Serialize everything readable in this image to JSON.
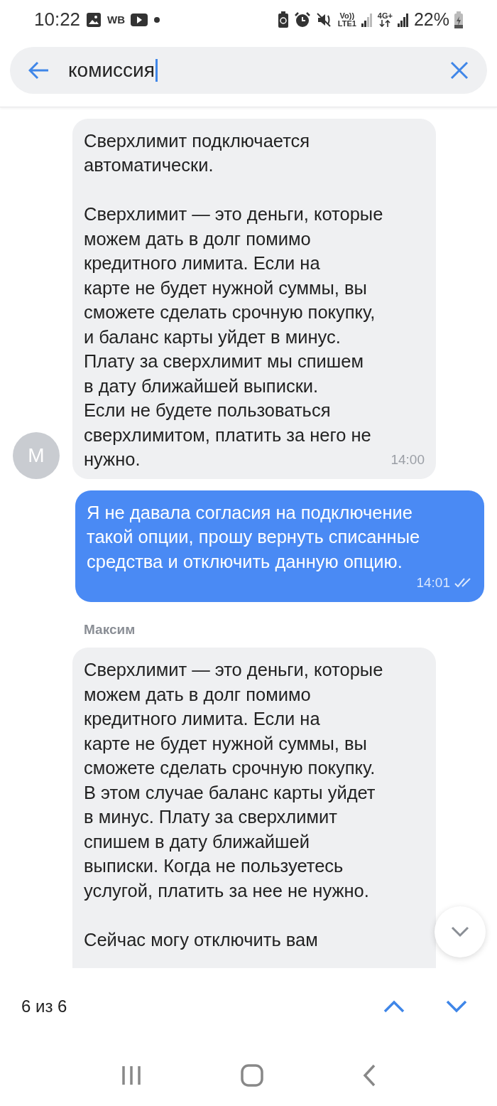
{
  "status_bar": {
    "time": "10:22",
    "wb_label": "WB",
    "volte_label": "Vo))",
    "lte_label": "LTE1",
    "network_label": "4G+",
    "battery": "22%"
  },
  "search": {
    "value": "комиссия"
  },
  "messages": [
    {
      "kind": "incoming",
      "avatar": "M",
      "paragraphs": [
        "Сверхлимит подключается\nавтоматически.",
        "Сверхлимит — это деньги, которые\nможем дать в долг помимо\nкредитного лимита. Если на\nкарте не будет нужной суммы, вы\nсможете сделать срочную покупку,\nи баланс карты уйдет в минус.\nПлату за сверхлимит мы спишем\nв дату ближайшей выписки.\nЕсли не будете пользоваться\nсверхлимитом, платить за него не\nнужно."
      ],
      "time": "14:00"
    },
    {
      "kind": "outgoing",
      "paragraphs": [
        "Я не давала согласия на подключение\nтакой опции, прошу вернуть списанные\nсредства и отключить данную опцию."
      ],
      "time": "14:01",
      "read": true
    },
    {
      "kind": "incoming",
      "sender": "Максим",
      "paragraphs": [
        "Сверхлимит — это деньги, которые\nможем дать в долг помимо\nкредитного лимита. Если на\nкарте не будет нужной суммы, вы\nсможете сделать срочную покупку.\nВ этом случае баланс карты уйдет\nв минус. Плату за сверхлимит\nспишем в дату ближайшей\nвыписки. Когда не пользуетесь\nуслугой, платить за нее не нужно.",
        "Сейчас могу отключить вам"
      ]
    }
  ],
  "find_bar": {
    "counter": "6 из 6"
  }
}
